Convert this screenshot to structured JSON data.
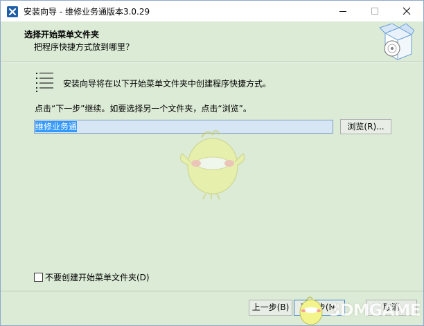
{
  "window": {
    "title": "安装向导 - 维修业务通版本3.0.29"
  },
  "header": {
    "title": "选择开始菜单文件夹",
    "subtitle": "把程序快捷方式放到哪里？"
  },
  "content": {
    "intro": "安装向导将在以下开始菜单文件夹中创建程序快捷方式。",
    "hint": "点击“下一步”继续。如要选择另一个文件夹，点击“浏览”。",
    "folder_value": "维修业务通",
    "browse_label": "浏览(R)...",
    "no_folder_checkbox_label": "不要创建开始菜单文件夹(D)",
    "no_folder_checked": false
  },
  "footer": {
    "back_label": "上一步(B)",
    "next_label": "下一步(N)",
    "cancel_label": "取消"
  },
  "watermark": {
    "text": "3DMGAME"
  },
  "colors": {
    "panel_bg": "#dcebd6",
    "selection": "#3399ff",
    "app_icon": "#1e5ea8"
  },
  "icons": {
    "app": "installer-x-icon",
    "minimize": "minimize-icon",
    "maximize": "maximize-icon",
    "close": "close-icon",
    "header_logo": "box-with-disc-icon",
    "list": "list-icon",
    "mascot": "chick-mascot-icon"
  }
}
